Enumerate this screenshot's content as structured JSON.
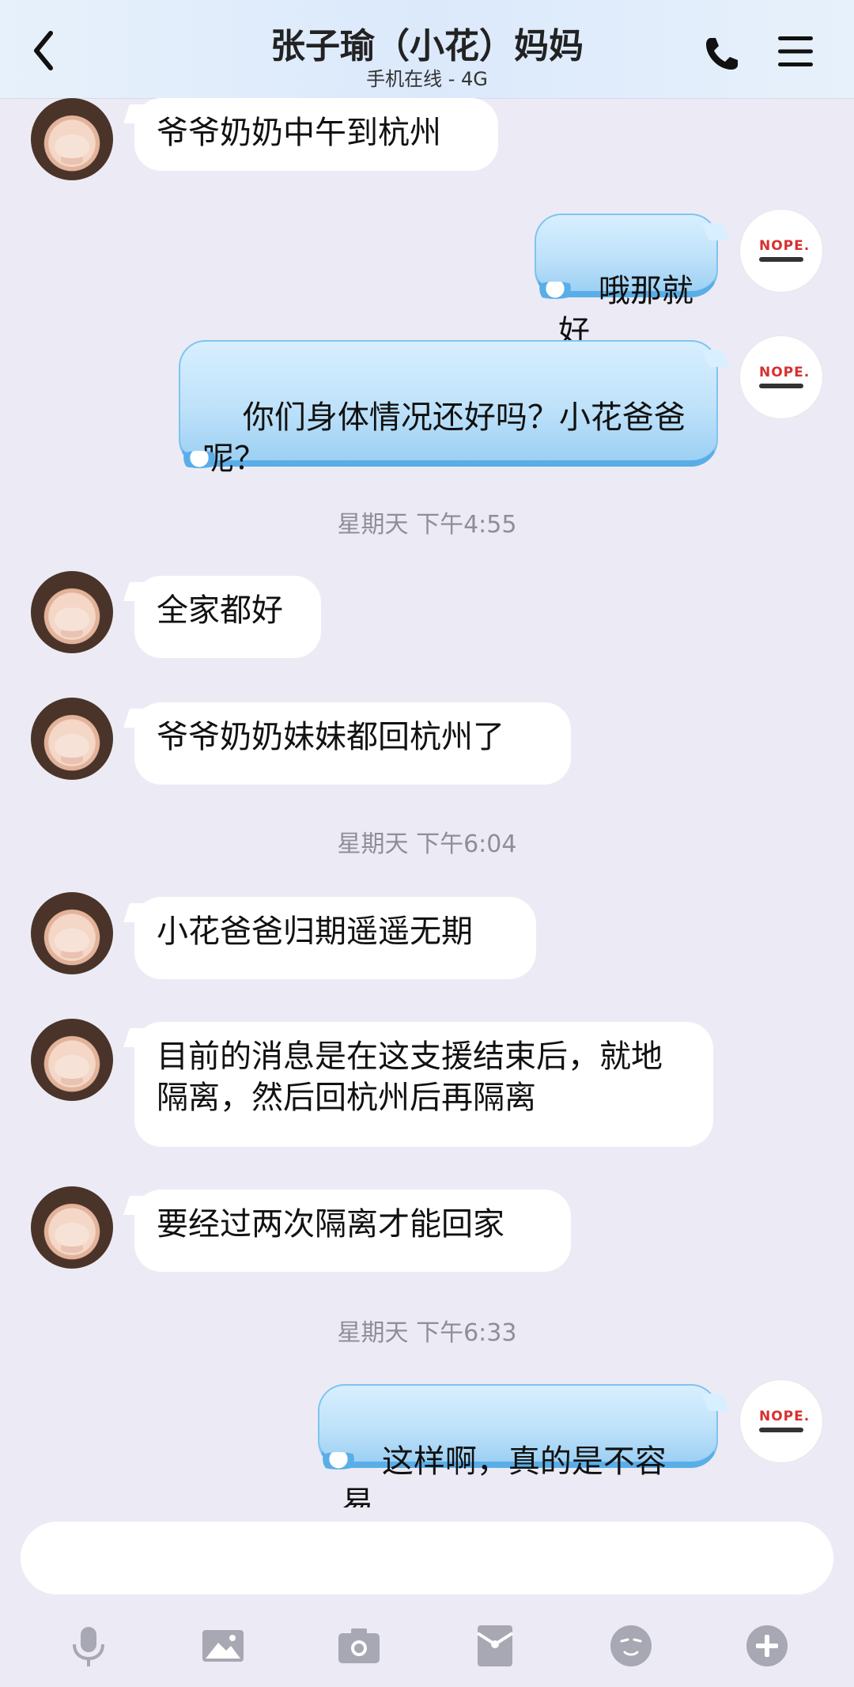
{
  "header": {
    "title": "张子瑜（小花）妈妈",
    "status": "手机在线 - 4G"
  },
  "messages": [
    {
      "side": "in",
      "text": "爷爷奶奶中午到杭州"
    },
    {
      "side": "out",
      "text": "哦那就好"
    },
    {
      "side": "out",
      "text": "你们身体情况还好吗？小花爸爸呢？"
    },
    {
      "timestamp": "星期天 下午4:55"
    },
    {
      "side": "in",
      "text": "全家都好"
    },
    {
      "side": "in",
      "text": "爷爷奶奶妹妹都回杭州了"
    },
    {
      "timestamp": "星期天 下午6:04"
    },
    {
      "side": "in",
      "text": "小花爸爸归期遥遥无期"
    },
    {
      "side": "in",
      "text": "目前的消息是在这支援结束后，就地隔离，然后回杭州后再隔离"
    },
    {
      "side": "in",
      "text": "要经过两次隔离才能回家"
    },
    {
      "timestamp": "星期天 下午6:33"
    },
    {
      "side": "out",
      "text": "这样啊，真的是不容易"
    }
  ],
  "avatars": {
    "self_logo_text": "NOPE."
  },
  "toolbar": [
    "microphone-icon",
    "image-icon",
    "camera-icon",
    "red-packet-icon",
    "emoji-icon",
    "plus-icon"
  ]
}
